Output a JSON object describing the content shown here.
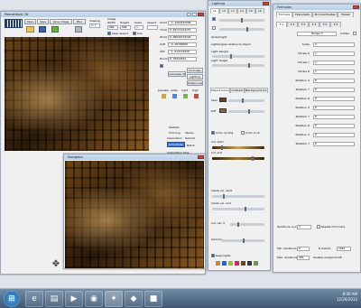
{
  "desktop": {
    "bg": "#dfe4ea"
  },
  "main_window": {
    "title": "Mandelbulb 3D",
    "tabs": [
      "Open",
      "Save",
      "Save image",
      "Misc"
    ],
    "viewing_label": "Viewing",
    "viewing_value": "1:1",
    "image_label": "Image",
    "width_label": "Width",
    "height_label": "Height",
    "scale_label": "Scale",
    "aspect_label": "Aspect",
    "width_value": "800",
    "height_value": "600",
    "scale_value": "1",
    "keep_aspect_label": "keep aspect",
    "use_label": "Use",
    "coords": [
      {
        "label": "Xmid",
        "value": "-1.4462432998"
      },
      {
        "label": "Ymid",
        "value": "0.09711613153"
      },
      {
        "label": "Zmid",
        "value": "0.08849732226"
      },
      {
        "label": "Xoff",
        "value": "-0.28700000"
      },
      {
        "label": "Yoff",
        "value": "-1.012712938"
      },
      {
        "label": "Zoom",
        "value": "0.78224563"
      }
    ],
    "calc_button": "Calculate 3D",
    "formulas_button": "Formulas",
    "lighting_button": "Lighting",
    "postprocess_button": "Postprocess",
    "preview_row": [
      "preview",
      "video",
      "right",
      "high"
    ],
    "statistic": "Statistic",
    "coloring": "Coloring",
    "stereo": "Stereo",
    "calculation": "Calculation",
    "tutorial": "Tutorial",
    "julia_mode": "Julia Mode",
    "batch": "Batch",
    "calc_time": "Calculation time"
  },
  "navigator": {
    "title": "Navigator"
  },
  "lighting": {
    "title": "Lighting",
    "tabs": [
      "L1",
      "L2",
      "L3",
      "L4",
      "L5",
      "L6"
    ],
    "global_light": "Global light",
    "lightangle_label": "Lightangles relative to object",
    "light_xangle": "Light Xangle",
    "light_yangle": "Light Yangle",
    "color_tabs": [
      "Object colors",
      "Ambient",
      "Background pic"
    ],
    "spec_label": "Spec",
    "diff_label": "Diff",
    "color_cycling": "Color cycling",
    "color_on_z": "Color on Z",
    "col_start": "Col. start",
    "col_end": "Col. end",
    "inside_start": "Inside col. start",
    "inside_end": "Inside col. end",
    "color_var": "Col. var. 2",
    "gamma_label": "Gamma",
    "keep_lights": "Keep lights"
  },
  "formulas": {
    "title": "Formulas",
    "tabs": [
      "Formula",
      "Interpolate",
      "3D Coordinates",
      "Preset"
    ],
    "formula_tabs": [
      "F 1",
      "F 2",
      "F 3",
      "F 4",
      "F 5",
      "F 6"
    ],
    "formula_name": "Menger3",
    "hidden_label": "hidden",
    "params": [
      {
        "label": "Scale",
        "value": "3"
      },
      {
        "label": "CScale X",
        "value": "1"
      },
      {
        "label": "CScale Y",
        "value": "1"
      },
      {
        "label": "CScale Z",
        "value": "1"
      },
      {
        "label": "Rotation X",
        "value": "0"
      },
      {
        "label": "Rotation Y",
        "value": "0"
      },
      {
        "label": "Rotation Z",
        "value": "0"
      },
      {
        "label": "Rotation X",
        "value": "0"
      },
      {
        "label": "Rotation Y",
        "value": "0"
      },
      {
        "label": "Rotation Z",
        "value": "0"
      },
      {
        "label": "Rotation X",
        "value": "0"
      },
      {
        "label": "Rotation Y",
        "value": "0"
      }
    ],
    "iterations_label": "Iterations count",
    "iterations_value": "1",
    "repeat_label": "Repeat from here",
    "min_iter_label": "Min. iterations",
    "min_iter_value": "0",
    "max_iter_label": "Max. iterations",
    "max_iter_value": "300",
    "rstop_label": "R bailout",
    "rstop_value": "1024",
    "dealiasing_label": "Disable analytical DE"
  },
  "taskbar": {
    "items": [
      "start",
      "ie",
      "explorer",
      "media",
      "firefox",
      "mandelbulb",
      "app",
      "app2"
    ],
    "time": "8:00 AM",
    "date": "12/29/2012"
  }
}
